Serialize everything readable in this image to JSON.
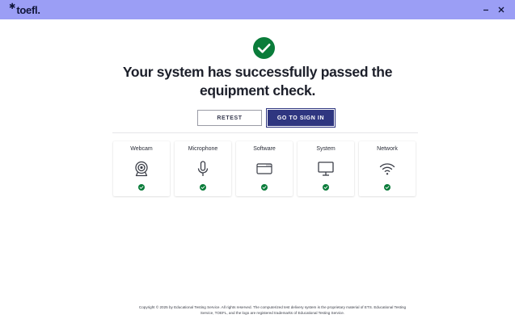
{
  "titlebar": {
    "logo_text": "toefl",
    "logo_dot": ".",
    "bg_color": "#9b9ef5"
  },
  "status": {
    "icon": "check-circle-icon",
    "color": "#0a7c3a",
    "headline_line1": "Your system has successfully passed the",
    "headline_line2": "equipment check."
  },
  "actions": {
    "retest_label": "RETEST",
    "sign_in_label": "GO TO SIGN IN"
  },
  "checks": [
    {
      "label": "Webcam",
      "icon": "webcam-icon",
      "status": "passed"
    },
    {
      "label": "Microphone",
      "icon": "microphone-icon",
      "status": "passed"
    },
    {
      "label": "Software",
      "icon": "browser-window-icon",
      "status": "passed"
    },
    {
      "label": "System",
      "icon": "monitor-icon",
      "status": "passed"
    },
    {
      "label": "Network",
      "icon": "wifi-icon",
      "status": "passed"
    }
  ],
  "footer": {
    "line1": "Copyright © 2025 by Educational Testing Service. All rights reserved. The computerized test delivery system is the proprietary material of ETS. Educational Testing",
    "line2": "Service, TOEFL, and the logo are registered trademarks of Educational Testing Service."
  }
}
